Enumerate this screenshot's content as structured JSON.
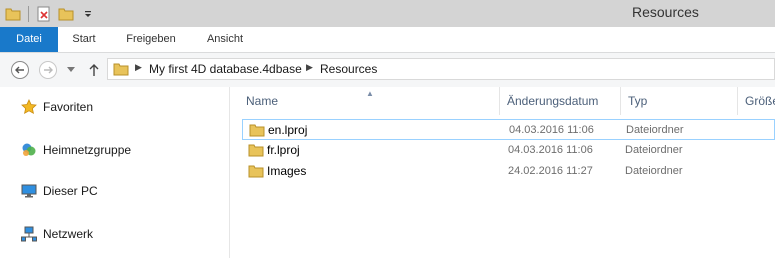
{
  "window": {
    "title": "Resources"
  },
  "ribbon": {
    "tabs": [
      {
        "label": "Datei",
        "active": true
      },
      {
        "label": "Start",
        "active": false
      },
      {
        "label": "Freigeben",
        "active": false
      },
      {
        "label": "Ansicht",
        "active": false
      }
    ]
  },
  "address": {
    "breadcrumbs": [
      "My first 4D database.4dbase",
      "Resources"
    ]
  },
  "nav_pane": {
    "items": [
      {
        "label": "Favoriten",
        "icon": "star-icon"
      },
      {
        "label": "Heimnetzgruppe",
        "icon": "homegroup-icon"
      },
      {
        "label": "Dieser PC",
        "icon": "computer-icon"
      },
      {
        "label": "Netzwerk",
        "icon": "network-icon"
      }
    ]
  },
  "file_list": {
    "columns": [
      "Name",
      "Änderungsdatum",
      "Typ",
      "Größe"
    ],
    "rows": [
      {
        "name": "en.lproj",
        "date": "04.03.2016 11:06",
        "type": "Dateiordner",
        "selected": true
      },
      {
        "name": "fr.lproj",
        "date": "04.03.2016 11:06",
        "type": "Dateiordner",
        "selected": false
      },
      {
        "name": "Images",
        "date": "24.02.2016 11:27",
        "type": "Dateiordner",
        "selected": false
      }
    ]
  },
  "colors": {
    "accent": "#1979ca",
    "titlebar": "#d4d4d4",
    "selection_border": "#99d1ff",
    "folder": "#e8c35a"
  }
}
